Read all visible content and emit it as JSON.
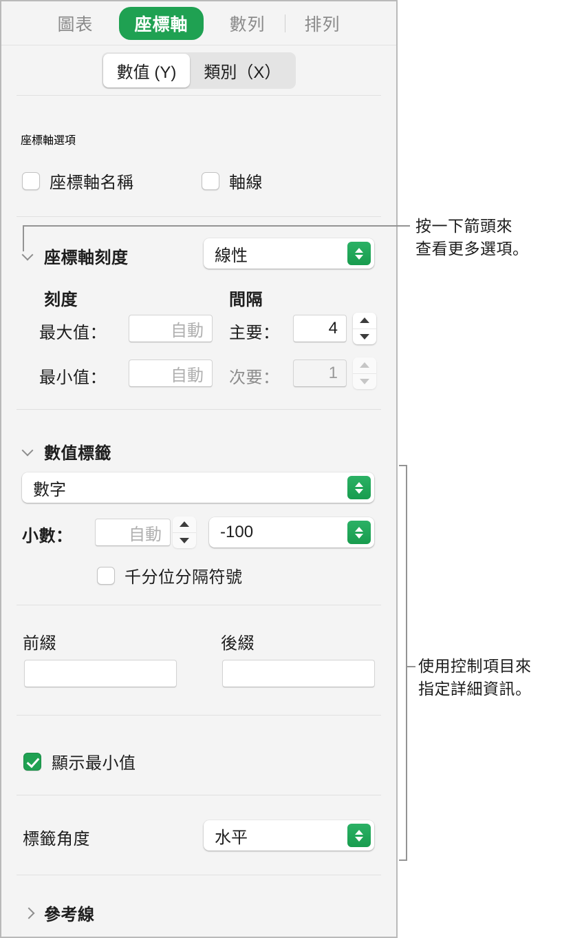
{
  "panel": {
    "tabs": [
      {
        "label": "圖表",
        "active": false
      },
      {
        "label": "座標軸",
        "active": true
      },
      {
        "label": "數列",
        "active": false
      },
      {
        "label": "排列",
        "active": false
      }
    ],
    "segmented": [
      {
        "label": "數值 (Y)",
        "active": true
      },
      {
        "label": "類別（X）",
        "active": false
      }
    ],
    "axis_options": {
      "title": "座標軸選項",
      "checkbox_axis_name": {
        "label": "座標軸名稱",
        "checked": false
      },
      "checkbox_axis_line": {
        "label": "軸線",
        "checked": false
      }
    },
    "axis_scale": {
      "title": "座標軸刻度",
      "scale_value": "線性",
      "col_scale_header": "刻度",
      "col_interval_header": "間隔",
      "max_label": "最大值：",
      "max_placeholder": "自動",
      "max_value": "",
      "min_label": "最小值：",
      "min_placeholder": "自動",
      "min_value": "",
      "major_label": "主要：",
      "major_value": "4",
      "minor_label": "次要：",
      "minor_value": "1"
    },
    "value_labels": {
      "title": "數值標籤",
      "format_value": "數字",
      "decimals_label": "小數：",
      "decimals_placeholder": "自動",
      "decimals_value": "",
      "negative_style_value": "-100",
      "checkbox_thousands": {
        "label": "千分位分隔符號",
        "checked": false
      },
      "prefix_label": "前綴",
      "prefix_value": "",
      "suffix_label": "後綴",
      "suffix_value": "",
      "checkbox_show_min": {
        "label": "顯示最小值",
        "checked": true
      },
      "label_angle_label": "標籤角度",
      "label_angle_value": "水平"
    },
    "reference_lines": {
      "title": "參考線"
    }
  },
  "callouts": [
    {
      "text": "按一下箭頭來\n查看更多選項。"
    },
    {
      "text": "使用控制項目來\n指定詳細資訊。"
    }
  ],
  "colors": {
    "accent_green": "#1fa152",
    "panel_bg": "#f4f4f4",
    "text": "#1d1d1d"
  }
}
